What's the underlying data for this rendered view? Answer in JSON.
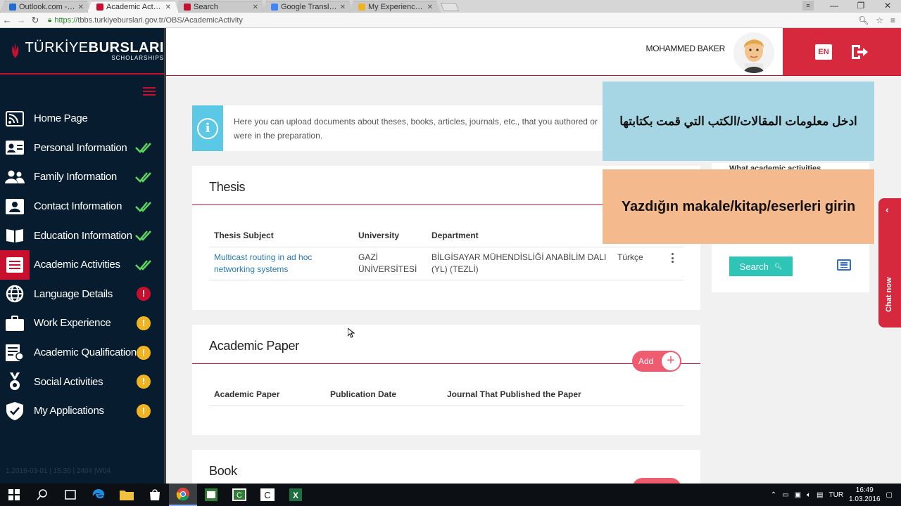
{
  "browser": {
    "tabs": [
      {
        "label": "Outlook.com - moha",
        "favicon_color": "#1e6fd0",
        "active": false
      },
      {
        "label": "Academic Activities",
        "favicon_color": "#c8102e",
        "active": true
      },
      {
        "label": "Search",
        "favicon_color": "#c8102e",
        "active": false
      },
      {
        "label": "Google Translate",
        "favicon_color": "#4285f4",
        "active": false
      },
      {
        "label": "My Experiences With",
        "favicon_color": "#f0b420",
        "active": false
      }
    ],
    "url_protocol": "https://",
    "url_rest": "tbbs.turkiyeburslari.gov.tr/OBS/AcademicActivity"
  },
  "brand": {
    "main_light": "TÜRKİYE",
    "main_bold": "BURSLARI",
    "sub": "SCHOLARSHIPS",
    "color": "#c8102e"
  },
  "sidebar": {
    "items": [
      {
        "label": "Home Page",
        "icon": "rss-icon",
        "status": ""
      },
      {
        "label": "Personal Information",
        "icon": "id-card-icon",
        "status": "done"
      },
      {
        "label": "Family Information",
        "icon": "people-icon",
        "status": "done"
      },
      {
        "label": "Contact Information",
        "icon": "contact-card-icon",
        "status": "done"
      },
      {
        "label": "Education Information",
        "icon": "book-icon",
        "status": "done"
      },
      {
        "label": "Academic Activities",
        "icon": "list-icon",
        "status": "done",
        "active": true
      },
      {
        "label": "Language Details",
        "icon": "globe-icon",
        "status": "error"
      },
      {
        "label": "Work Experience",
        "icon": "briefcase-icon",
        "status": "warning"
      },
      {
        "label": "Academic Qualification",
        "icon": "certificate-icon",
        "status": "warning"
      },
      {
        "label": "Social Activities",
        "icon": "medal-icon",
        "status": "warning"
      },
      {
        "label": "My Applications",
        "icon": "shield-check-icon",
        "status": "warning"
      }
    ],
    "version": "1.2016-03-01 | 15:30 | 2404 |W04"
  },
  "header": {
    "username": "MOHAMMED BAKER",
    "lang_label": "EN"
  },
  "info": {
    "text": "Here you can upload documents about theses, books, articles, journals, etc., that you authored or were in the preparation."
  },
  "thesis": {
    "title": "Thesis",
    "columns": [
      "Thesis Subject",
      "University",
      "Department"
    ],
    "rows": [
      {
        "subject": "Multicast routing in ad hoc networking systems",
        "university": "GAZİ ÜNİVERSİTESİ",
        "department": "BİLGİSAYAR MÜHENDİSLİĞİ ANABİLİM DALI (YL) (TEZLİ)",
        "language": "Türkçe"
      }
    ]
  },
  "paper": {
    "title": "Academic Paper",
    "add_label": "Add",
    "columns": [
      "Academic Paper",
      "Publication Date",
      "Journal That Published the Paper"
    ]
  },
  "book": {
    "title": "Book"
  },
  "right_panel": {
    "text": "What academic activities",
    "search_label": "Search"
  },
  "chat": {
    "label": "Chat now"
  },
  "overlays": {
    "arabic": "ادخل معلومات المقالات/الكتب التي قمت بكتابتها",
    "turkish": "Yazdığın makale/kitap/eserleri girin"
  },
  "taskbar": {
    "lang": "TUR",
    "time": "16:49",
    "date": "1.03.2016"
  }
}
